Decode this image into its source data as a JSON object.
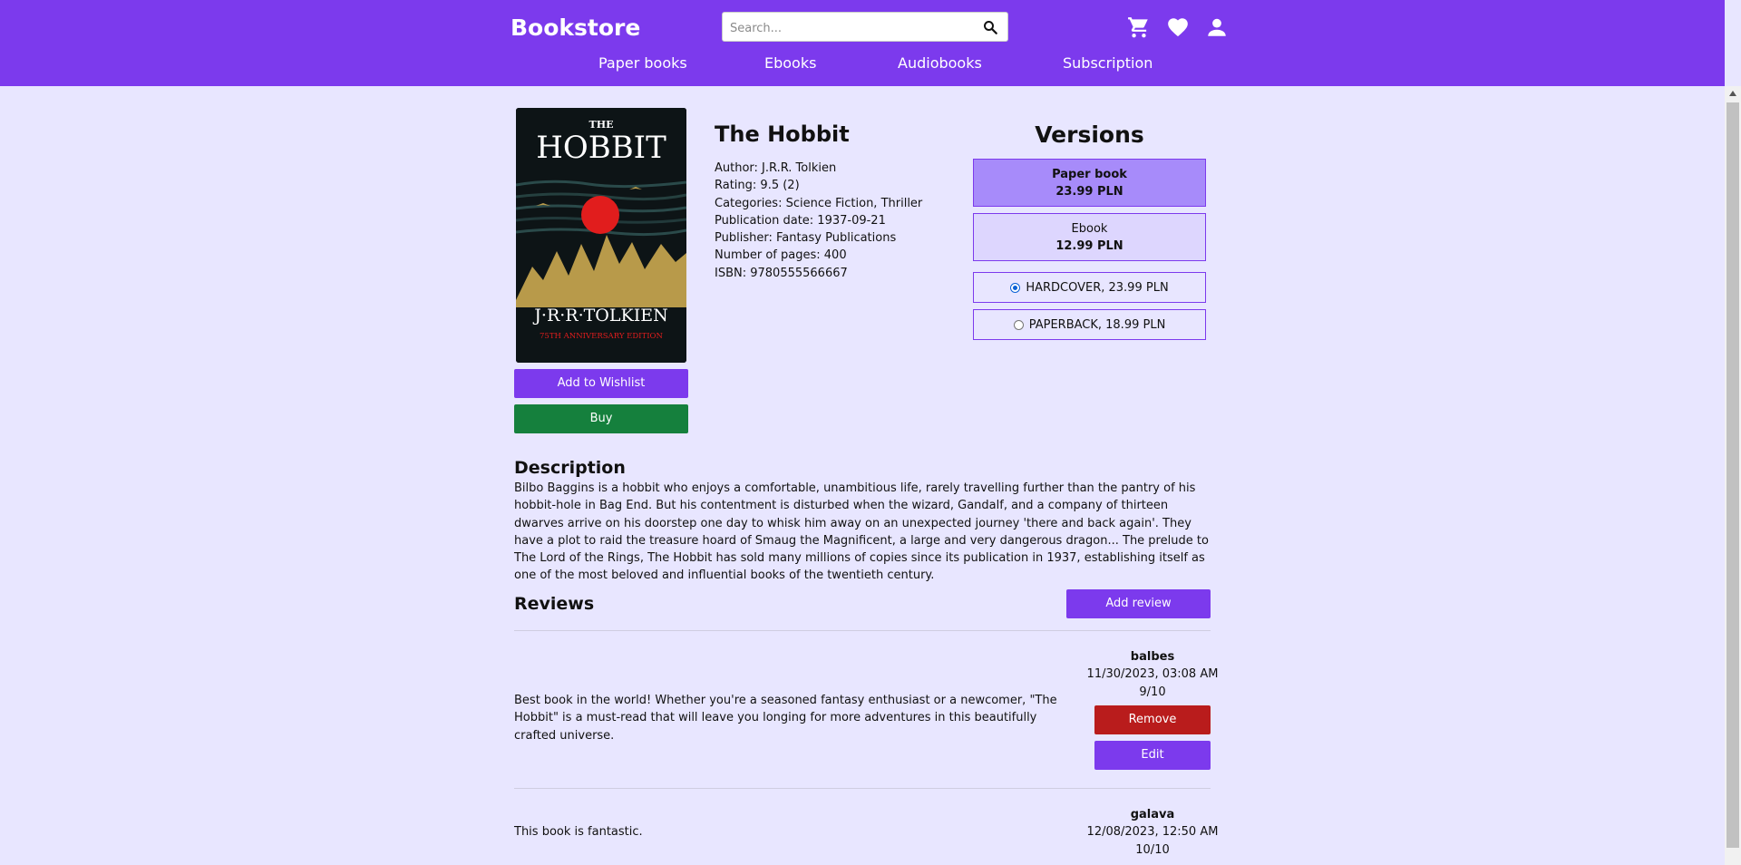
{
  "header": {
    "brand": "Bookstore",
    "search_placeholder": "Search...",
    "nav": [
      "Paper books",
      "Ebooks",
      "Audiobooks",
      "Subscription"
    ]
  },
  "cover": {
    "title_small": "THE",
    "title_big": "HOBBIT",
    "author": "J·R·R·TOLKIEN",
    "edition": "75TH ANNIVERSARY EDITION"
  },
  "actions": {
    "wishlist": "Add to Wishlist",
    "buy": "Buy"
  },
  "book": {
    "title": "The Hobbit",
    "author": "Author: J.R.R. Tolkien",
    "rating": "Rating: 9.5 (2)",
    "categories": "Categories: Science Fiction, Thriller",
    "publication_date": "Publication date: 1937-09-21",
    "publisher": "Publisher: Fantasy Publications",
    "pages": "Number of pages: 400",
    "isbn": "ISBN: 9780555566667"
  },
  "versions": {
    "title": "Versions",
    "cards": [
      {
        "name": "Paper book",
        "price": "23.99 PLN"
      },
      {
        "name": "Ebook",
        "price": "12.99 PLN"
      }
    ],
    "options": [
      {
        "label": "HARDCOVER, 23.99 PLN",
        "selected": true
      },
      {
        "label": "PAPERBACK, 18.99 PLN",
        "selected": false
      }
    ]
  },
  "description": {
    "heading": "Description",
    "text": "Bilbo Baggins is a hobbit who enjoys a comfortable, unambitious life, rarely travelling further than the pantry of his hobbit-hole in Bag End. But his contentment is disturbed when the wizard, Gandalf, and a company of thirteen dwarves arrive on his doorstep one day to whisk him away on an unexpected journey 'there and back again'. They have a plot to raid the treasure hoard of Smaug the Magnificent, a large and very dangerous dragon... The prelude to The Lord of the Rings, The Hobbit has sold many millions of copies since its publication in 1937, establishing itself as one of the most beloved and influential books of the twentieth century."
  },
  "reviews": {
    "heading": "Reviews",
    "add_label": "Add review",
    "items": [
      {
        "user": "balbes",
        "date": "11/30/2023, 03:08 AM",
        "score": "9/10",
        "text": "Best book in the world! Whether you're a seasoned fantasy enthusiast or a newcomer, \"The Hobbit\" is a must-read that will leave you longing for more adventures in this beautifully crafted universe.",
        "remove_label": "Remove",
        "edit_label": "Edit"
      },
      {
        "user": "galava",
        "date": "12/08/2023, 12:50 AM",
        "score": "10/10",
        "text": "This book is fantastic."
      }
    ]
  },
  "colors": {
    "brand": "#7c3aed",
    "page_bg": "#e8e6ff",
    "buy": "#15803d",
    "remove": "#b91c1c"
  },
  "icons": [
    "search-icon",
    "cart-icon",
    "heart-icon",
    "user-icon"
  ]
}
